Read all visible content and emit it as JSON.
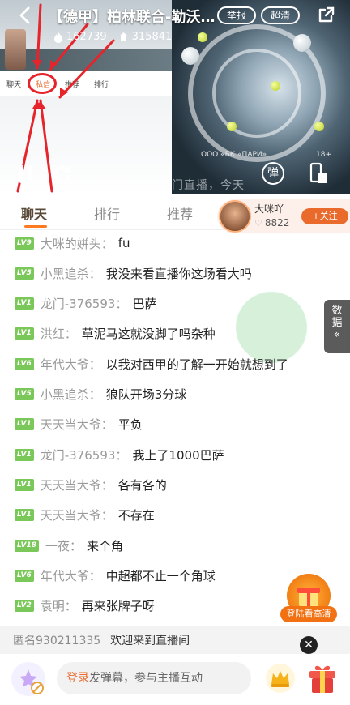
{
  "header": {
    "title": "【德甲】柏林联合-勒沃…",
    "report_label": "举报",
    "hd_label": "超清",
    "popularity": "162739",
    "followers": "315841"
  },
  "video": {
    "sponsor_text": "ООО «БК «ПАРИ»",
    "age_rating": "18+",
    "caption": "门直播，今天",
    "danmaku_label": "弹"
  },
  "tabs": [
    {
      "label": "聊天",
      "active": true
    },
    {
      "label": "排行",
      "active": false
    },
    {
      "label": "推荐",
      "active": false
    }
  ],
  "streamer": {
    "name": "大咪吖",
    "fans": "8822",
    "follow_label": "+关注"
  },
  "chat": [
    {
      "level": "LV9",
      "user": "大咪的姘头",
      "text": "fu"
    },
    {
      "level": "LV5",
      "user": "小黑追杀",
      "text": "我没来看直播你这场看大吗"
    },
    {
      "level": "LV1",
      "user": "龙门-376593",
      "text": "巴萨"
    },
    {
      "level": "LV1",
      "user": "洪红",
      "text": "草泥马这就没脚了吗杂种"
    },
    {
      "level": "LV6",
      "user": "年代大爷",
      "text": "以我对西甲的了解一开始就想到了"
    },
    {
      "level": "LV5",
      "user": "小黑追杀",
      "text": "狼队开场3分球"
    },
    {
      "level": "LV1",
      "user": "天天当大爷",
      "text": "平负"
    },
    {
      "level": "LV1",
      "user": "龙门-376593",
      "text": "我上了1000巴萨"
    },
    {
      "level": "LV1",
      "user": "天天当大爷",
      "text": "各有各的"
    },
    {
      "level": "LV1",
      "user": "天天当大爷",
      "text": "不存在"
    },
    {
      "level": "LV18",
      "user": "一夜",
      "text": "来个角"
    },
    {
      "level": "LV6",
      "user": "年代大爷",
      "text": "中超都不止一个角球"
    },
    {
      "level": "LV2",
      "user": "袁明",
      "text": "再来张牌子呀"
    }
  ],
  "data_tab_label": "数据",
  "gift_promo_label": "登陆看高清",
  "welcome": {
    "user": "匿名930211335",
    "text": "欢迎来到直播间"
  },
  "input": {
    "login": "登录",
    "prompt": "发弹幕，参与主播互动"
  },
  "colors": {
    "accent": "#e96a2b",
    "level_badge": "#7bc85a",
    "red_annotation": "#e5242b"
  }
}
